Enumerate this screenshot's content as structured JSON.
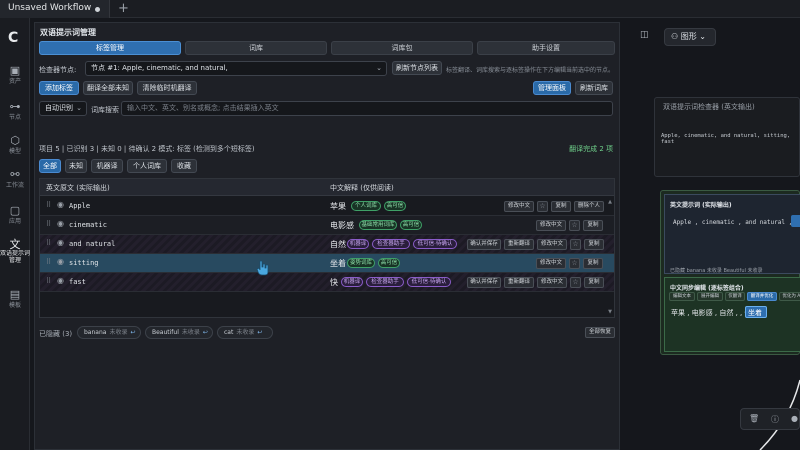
{
  "tab": {
    "title": "Unsaved Workflow"
  },
  "sidebar": {
    "items": [
      {
        "label": "资产",
        "icon": "image-icon"
      },
      {
        "label": "节点",
        "icon": "node-icon"
      },
      {
        "label": "模型",
        "icon": "cube-icon"
      },
      {
        "label": "工作流",
        "icon": "workflow-icon"
      },
      {
        "label": "应用",
        "icon": "app-icon"
      },
      {
        "label": "双语提示词管理",
        "icon": "translate-icon"
      },
      {
        "label": "模板",
        "icon": "template-icon"
      }
    ]
  },
  "panel": {
    "title": "双语提示词管理",
    "segments": [
      "标签管理",
      "词库",
      "词库包",
      "助手设置"
    ],
    "node_label": "检查器节点:",
    "node_value": "节点 #1: Apple, cinematic, and natural,",
    "refresh_nodes": "刷新节点列表",
    "top_hint": "标签翻译、词库搜索与逐标签操作在下方编辑当前选中的节点。",
    "add_tag": "添加标签",
    "translate_unknown": "翻译全部未知",
    "clear_temp": "清除临时机翻译",
    "manage_panel": "管理面板",
    "refresh_lib": "刷新词库",
    "auto_detect": "自动识别",
    "search_label": "词库搜索",
    "search_placeholder": "输入中文、英文、别名或概念; 点击结果插入英文",
    "status": "项目 5 | 已识别 3 | 未知 0 | 待确认 2  模式: 标签 (检测到多个短标签)",
    "status_right": "翻译完成 2 项",
    "filters": [
      "全部",
      "未知",
      "机器译",
      "个人词库",
      "收藏"
    ],
    "col_en": "英文原文 (实际输出)",
    "col_zh": "中文解释 (仅供阅读)",
    "rows": [
      {
        "en": "Apple",
        "zh": "苹果",
        "tags": [
          "个人词库",
          "高可信"
        ],
        "actions": [
          "修改中文",
          "复制",
          "删除个人"
        ]
      },
      {
        "en": "cinematic",
        "zh": "电影感",
        "tags": [
          "基础常用词库",
          "高可信"
        ],
        "actions": [
          "修改中文",
          "复制"
        ]
      },
      {
        "en": "and natural",
        "zh": "自然",
        "tags": [
          "机器译",
          "检查器助手",
          "低可信·待确认"
        ],
        "actions": [
          "确认并保存",
          "重新翻译",
          "修改中文",
          "复制"
        ]
      },
      {
        "en": "sitting",
        "zh": "坐着",
        "tags": [
          "姿势词库",
          "高可信"
        ],
        "actions": [
          "修改中文",
          "复制"
        ]
      },
      {
        "en": "fast",
        "zh": "快",
        "tags": [
          "机器译",
          "检查器助手",
          "低可信·待确认"
        ],
        "actions": [
          "确认并保存",
          "重新翻译",
          "修改中文",
          "复制"
        ]
      }
    ],
    "hidden_label": "已隐藏 (3)",
    "hidden": [
      {
        "en": "banana",
        "state": "未收录"
      },
      {
        "en": "Beautiful",
        "state": "未收录"
      },
      {
        "en": "cat",
        "state": "未收录"
      }
    ],
    "restore_all": "全部恢复"
  },
  "right": {
    "graph_label": "图形",
    "node1_title": "双语提示词检查器 (英文输出)",
    "node1_text": "Apple, cinematic, and natural, sitting, fast",
    "node2_title": "英文提示词 (实际输出)",
    "node2_en": "Apple , cinematic , and natural ,",
    "node2_hidden": "已隐藏  banana 未收录  Beautiful 未收录",
    "node2_zh_title": "中文同步编辑 (逐标签组合)",
    "node2_tabs": [
      "编辑文本",
      "展开编辑",
      "仅翻译",
      "翻译并优化",
      "优化为 Ai"
    ],
    "node2_zh": "苹果 , 电影感 , 自然 ,           , 快",
    "node2_zh_sel": "坐着"
  }
}
